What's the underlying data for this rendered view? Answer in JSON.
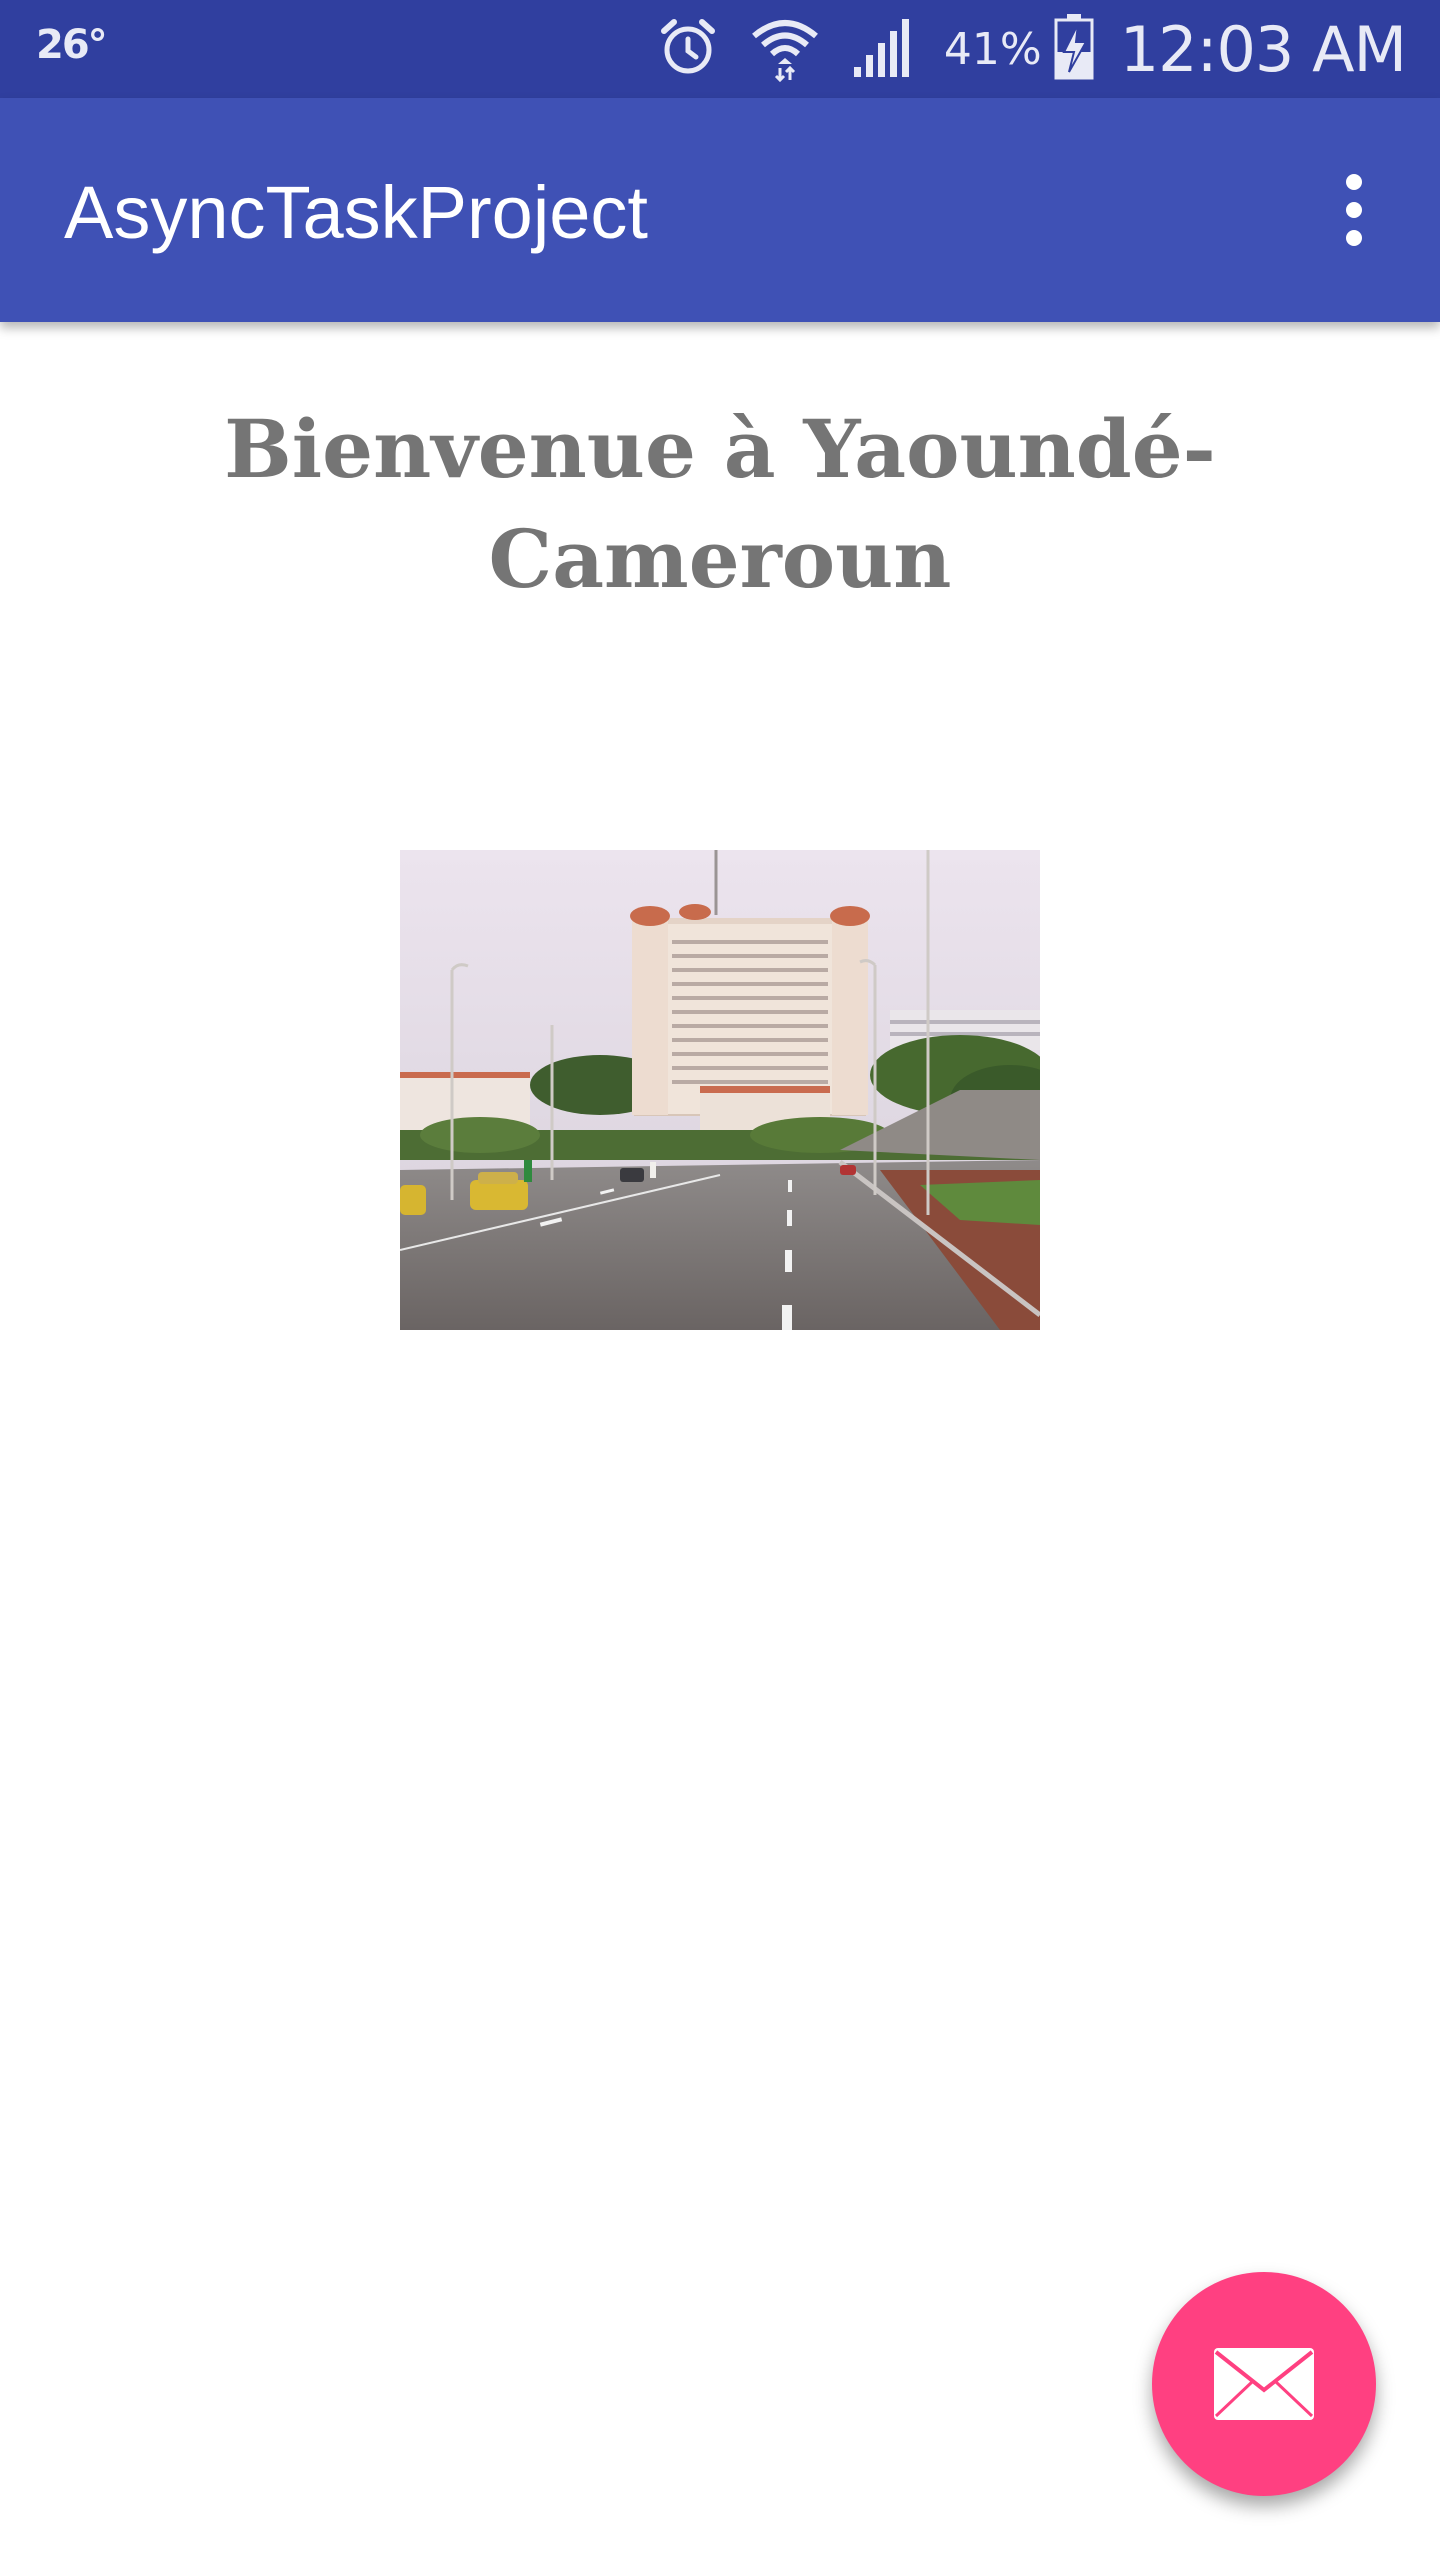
{
  "status_bar": {
    "temperature": "26°",
    "battery_percent": "41%",
    "time": "12:03 AM",
    "icons": [
      "alarm-icon",
      "wifi-icon",
      "signal-icon",
      "battery-charging-icon"
    ]
  },
  "app_bar": {
    "title": "AsyncTaskProject",
    "overflow_icon": "more-vert-icon"
  },
  "main": {
    "welcome_text": "Bienvenue à Yaoundé-Cameroun",
    "image_icon": "city-boulevard-photo"
  },
  "fab": {
    "icon": "mail-icon",
    "color": "#ff4081"
  },
  "colors": {
    "status_bar": "#303f9f",
    "primary": "#3f51b5",
    "accent": "#ff4081",
    "heading_text": "#757575"
  }
}
